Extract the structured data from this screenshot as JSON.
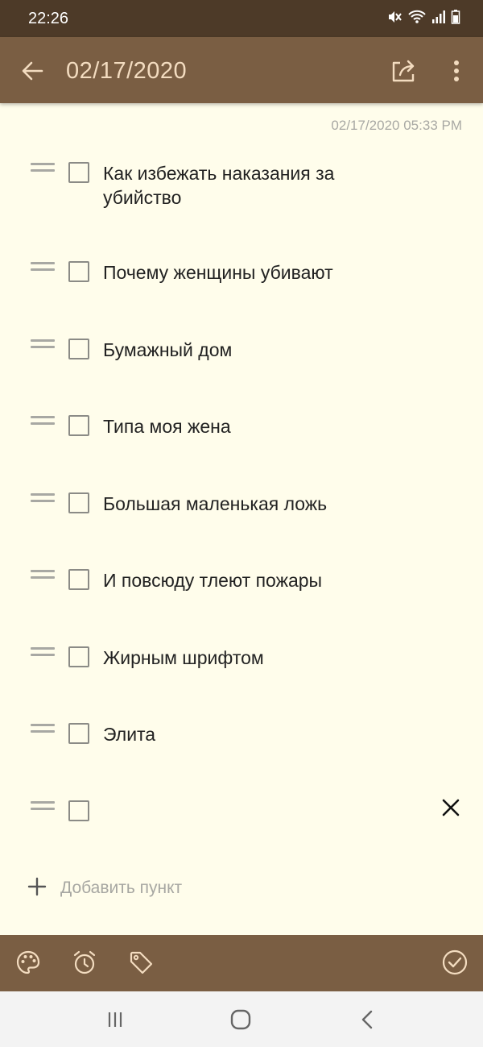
{
  "status_bar": {
    "time": "22:26",
    "icons": [
      "mute-icon",
      "wifi-icon",
      "signal-icon",
      "battery-icon"
    ]
  },
  "app_bar": {
    "title": "02/17/2020",
    "icons": [
      "back-arrow-icon",
      "share-icon",
      "more-vert-icon"
    ],
    "color": "#7a5e43"
  },
  "note": {
    "timestamp": "02/17/2020 05:33 PM",
    "items": [
      {
        "text": "Как избежать наказания за убийство",
        "checked": false
      },
      {
        "text": "Почему женщины убивают",
        "checked": false
      },
      {
        "text": "Бумажный дом",
        "checked": false
      },
      {
        "text": "Типа моя жена",
        "checked": false
      },
      {
        "text": "Большая маленькая ложь",
        "checked": false
      },
      {
        "text": "И повсюду тлеют пожары",
        "checked": false
      },
      {
        "text": "Жирным шрифтом",
        "checked": false
      },
      {
        "text": "Элита",
        "checked": false
      },
      {
        "text": "",
        "checked": false
      }
    ],
    "add_item_label": "Добавить пункт",
    "background": "#fffdeb"
  },
  "bottom_bar": {
    "icons": [
      "palette-icon",
      "alarm-icon",
      "tag-icon",
      "done-check-icon"
    ]
  },
  "nav_bar": {
    "icons": [
      "recents-icon",
      "home-icon",
      "back-icon"
    ]
  }
}
